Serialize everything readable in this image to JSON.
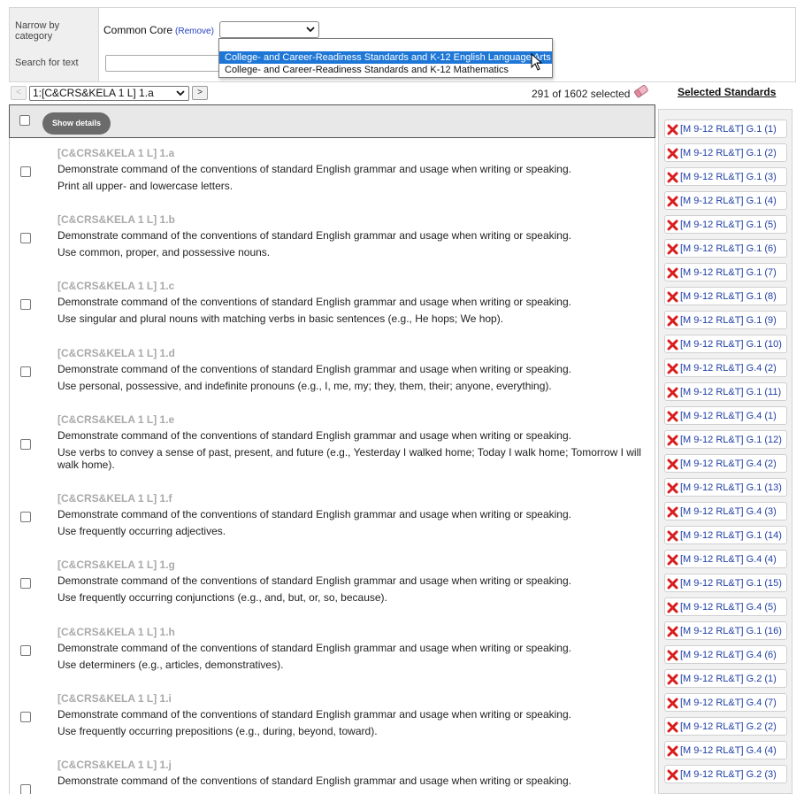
{
  "filter": {
    "narrow_label": "Narrow by category",
    "search_label": "Search for text",
    "common_core_label": "Common Core",
    "remove_label": "(Remove)",
    "search_value": "",
    "dropdown_options": [
      "College- and Career-Readiness Standards and K-12 English Language Arts",
      "College- and Career-Readiness Standards and K-12 Mathematics"
    ],
    "dropdown_selected_index": 0
  },
  "nav": {
    "prev_label": "<",
    "next_label": ">",
    "current_value": "1:[C&CRS&KELA 1 L] 1.a",
    "count_text": "291 of 1602 selected"
  },
  "list": {
    "show_details_label": "Show details",
    "items": [
      {
        "code": "[C&CRS&KELA 1 L] 1.a",
        "main": "Demonstrate command of the conventions of standard English grammar and usage when writing or speaking.",
        "detail": "Print all upper- and lowercase letters."
      },
      {
        "code": "[C&CRS&KELA 1 L] 1.b",
        "main": "Demonstrate command of the conventions of standard English grammar and usage when writing or speaking.",
        "detail": "Use common, proper, and possessive nouns."
      },
      {
        "code": "[C&CRS&KELA 1 L] 1.c",
        "main": "Demonstrate command of the conventions of standard English grammar and usage when writing or speaking.",
        "detail": "Use singular and plural nouns with matching verbs in basic sentences (e.g., He hops; We hop)."
      },
      {
        "code": "[C&CRS&KELA 1 L] 1.d",
        "main": "Demonstrate command of the conventions of standard English grammar and usage when writing or speaking.",
        "detail": "Use personal, possessive, and indefinite pronouns (e.g., I, me, my; they, them, their; anyone, everything)."
      },
      {
        "code": "[C&CRS&KELA 1 L] 1.e",
        "main": "Demonstrate command of the conventions of standard English grammar and usage when writing or speaking.",
        "detail": "Use verbs to convey a sense of past, present, and future (e.g., Yesterday I walked home; Today I walk home; Tomorrow I will walk home)."
      },
      {
        "code": "[C&CRS&KELA 1 L] 1.f",
        "main": "Demonstrate command of the conventions of standard English grammar and usage when writing or speaking.",
        "detail": "Use frequently occurring adjectives."
      },
      {
        "code": "[C&CRS&KELA 1 L] 1.g",
        "main": "Demonstrate command of the conventions of standard English grammar and usage when writing or speaking.",
        "detail": "Use frequently occurring conjunctions (e.g., and, but, or, so, because)."
      },
      {
        "code": "[C&CRS&KELA 1 L] 1.h",
        "main": "Demonstrate command of the conventions of standard English grammar and usage when writing or speaking.",
        "detail": "Use determiners (e.g., articles, demonstratives)."
      },
      {
        "code": "[C&CRS&KELA 1 L] 1.i",
        "main": "Demonstrate command of the conventions of standard English grammar and usage when writing or speaking.",
        "detail": "Use frequently occurring prepositions (e.g., during, beyond, toward)."
      },
      {
        "code": "[C&CRS&KELA 1 L] 1.j",
        "main": "Demonstrate command of the conventions of standard English grammar and usage when writing or speaking.",
        "detail": ""
      }
    ]
  },
  "selected": {
    "title": "Selected Standards",
    "items": [
      "[M 9-12 RL&T] G.1 (1)",
      "[M 9-12 RL&T] G.1 (2)",
      "[M 9-12 RL&T] G.1 (3)",
      "[M 9-12 RL&T] G.1 (4)",
      "[M 9-12 RL&T] G.1 (5)",
      "[M 9-12 RL&T] G.1 (6)",
      "[M 9-12 RL&T] G.1 (7)",
      "[M 9-12 RL&T] G.1 (8)",
      "[M 9-12 RL&T] G.1 (9)",
      "[M 9-12 RL&T] G.1 (10)",
      "[M 9-12 RL&T] G.4 (2)",
      "[M 9-12 RL&T] G.1 (11)",
      "[M 9-12 RL&T] G.4 (1)",
      "[M 9-12 RL&T] G.1 (12)",
      "[M 9-12 RL&T] G.4 (2)",
      "[M 9-12 RL&T] G.1 (13)",
      "[M 9-12 RL&T] G.4 (3)",
      "[M 9-12 RL&T] G.1 (14)",
      "[M 9-12 RL&T] G.4 (4)",
      "[M 9-12 RL&T] G.1 (15)",
      "[M 9-12 RL&T] G.4 (5)",
      "[M 9-12 RL&T] G.1 (16)",
      "[M 9-12 RL&T] G.4 (6)",
      "[M 9-12 RL&T] G.2 (1)",
      "[M 9-12 RL&T] G.4 (7)",
      "[M 9-12 RL&T] G.2 (2)",
      "[M 9-12 RL&T] G.4 (4)",
      "[M 9-12 RL&T] G.2 (3)"
    ]
  },
  "colors": {
    "dropdown_highlight": "#1e77d6",
    "link_blue": "#1f3fa3",
    "remove_red": "#d81e1e",
    "code_gray": "#aaaaaa"
  },
  "icons": {
    "remove": "red-x-icon",
    "eraser": "eraser-icon",
    "dropdown": "chevron-down-icon"
  }
}
